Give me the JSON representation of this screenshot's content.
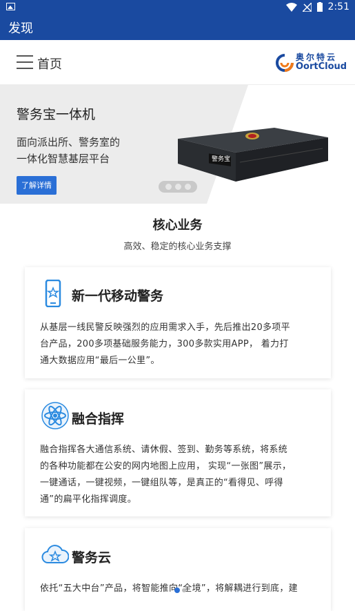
{
  "status_bar": {
    "time": "2:51"
  },
  "app_bar": {
    "title": "发现"
  },
  "nav": {
    "home_label": "首页",
    "logo_cn": "奥尔特云",
    "logo_en": "OortCloud"
  },
  "hero": {
    "title": "警务宝一体机",
    "line1": "面向派出所、警务室的",
    "line2": "一体化智慧基层平台",
    "button": "了解详情",
    "device_label": "警务宝"
  },
  "section": {
    "title": "核心业务",
    "subtitle": "高效、稳定的核心业务支撑"
  },
  "cards": [
    {
      "title": "新一代移动警务",
      "icon": "mobile-police-icon",
      "lines": [
        "从基层一线民警反映强烈的应用需求入手，先后推出20多项平",
        "台产品，200多项基础服务能力，300多款实用APP， 着力打",
        "通大数据应用“最后一公里”。"
      ]
    },
    {
      "title": "融合指挥",
      "icon": "atom-icon",
      "lines": [
        "融合指挥各大通信系统、请休假、签到、勤务等系统，将系统",
        "的各种功能都在公安的网内地图上应用， 实现“一张图”展示，",
        "一键通话，一键视频，一键组队等，是真正的“看得见、呼得",
        "通”的扁平化指挥调度。"
      ]
    },
    {
      "title": "警务云",
      "icon": "cloud-icon",
      "lines": [
        "依托“五大中台”产品，将智能推向“全境”，将解耦进行到底，建"
      ]
    }
  ],
  "colors": {
    "primary": "#1a4aa0",
    "accent": "#2a6fd6"
  }
}
